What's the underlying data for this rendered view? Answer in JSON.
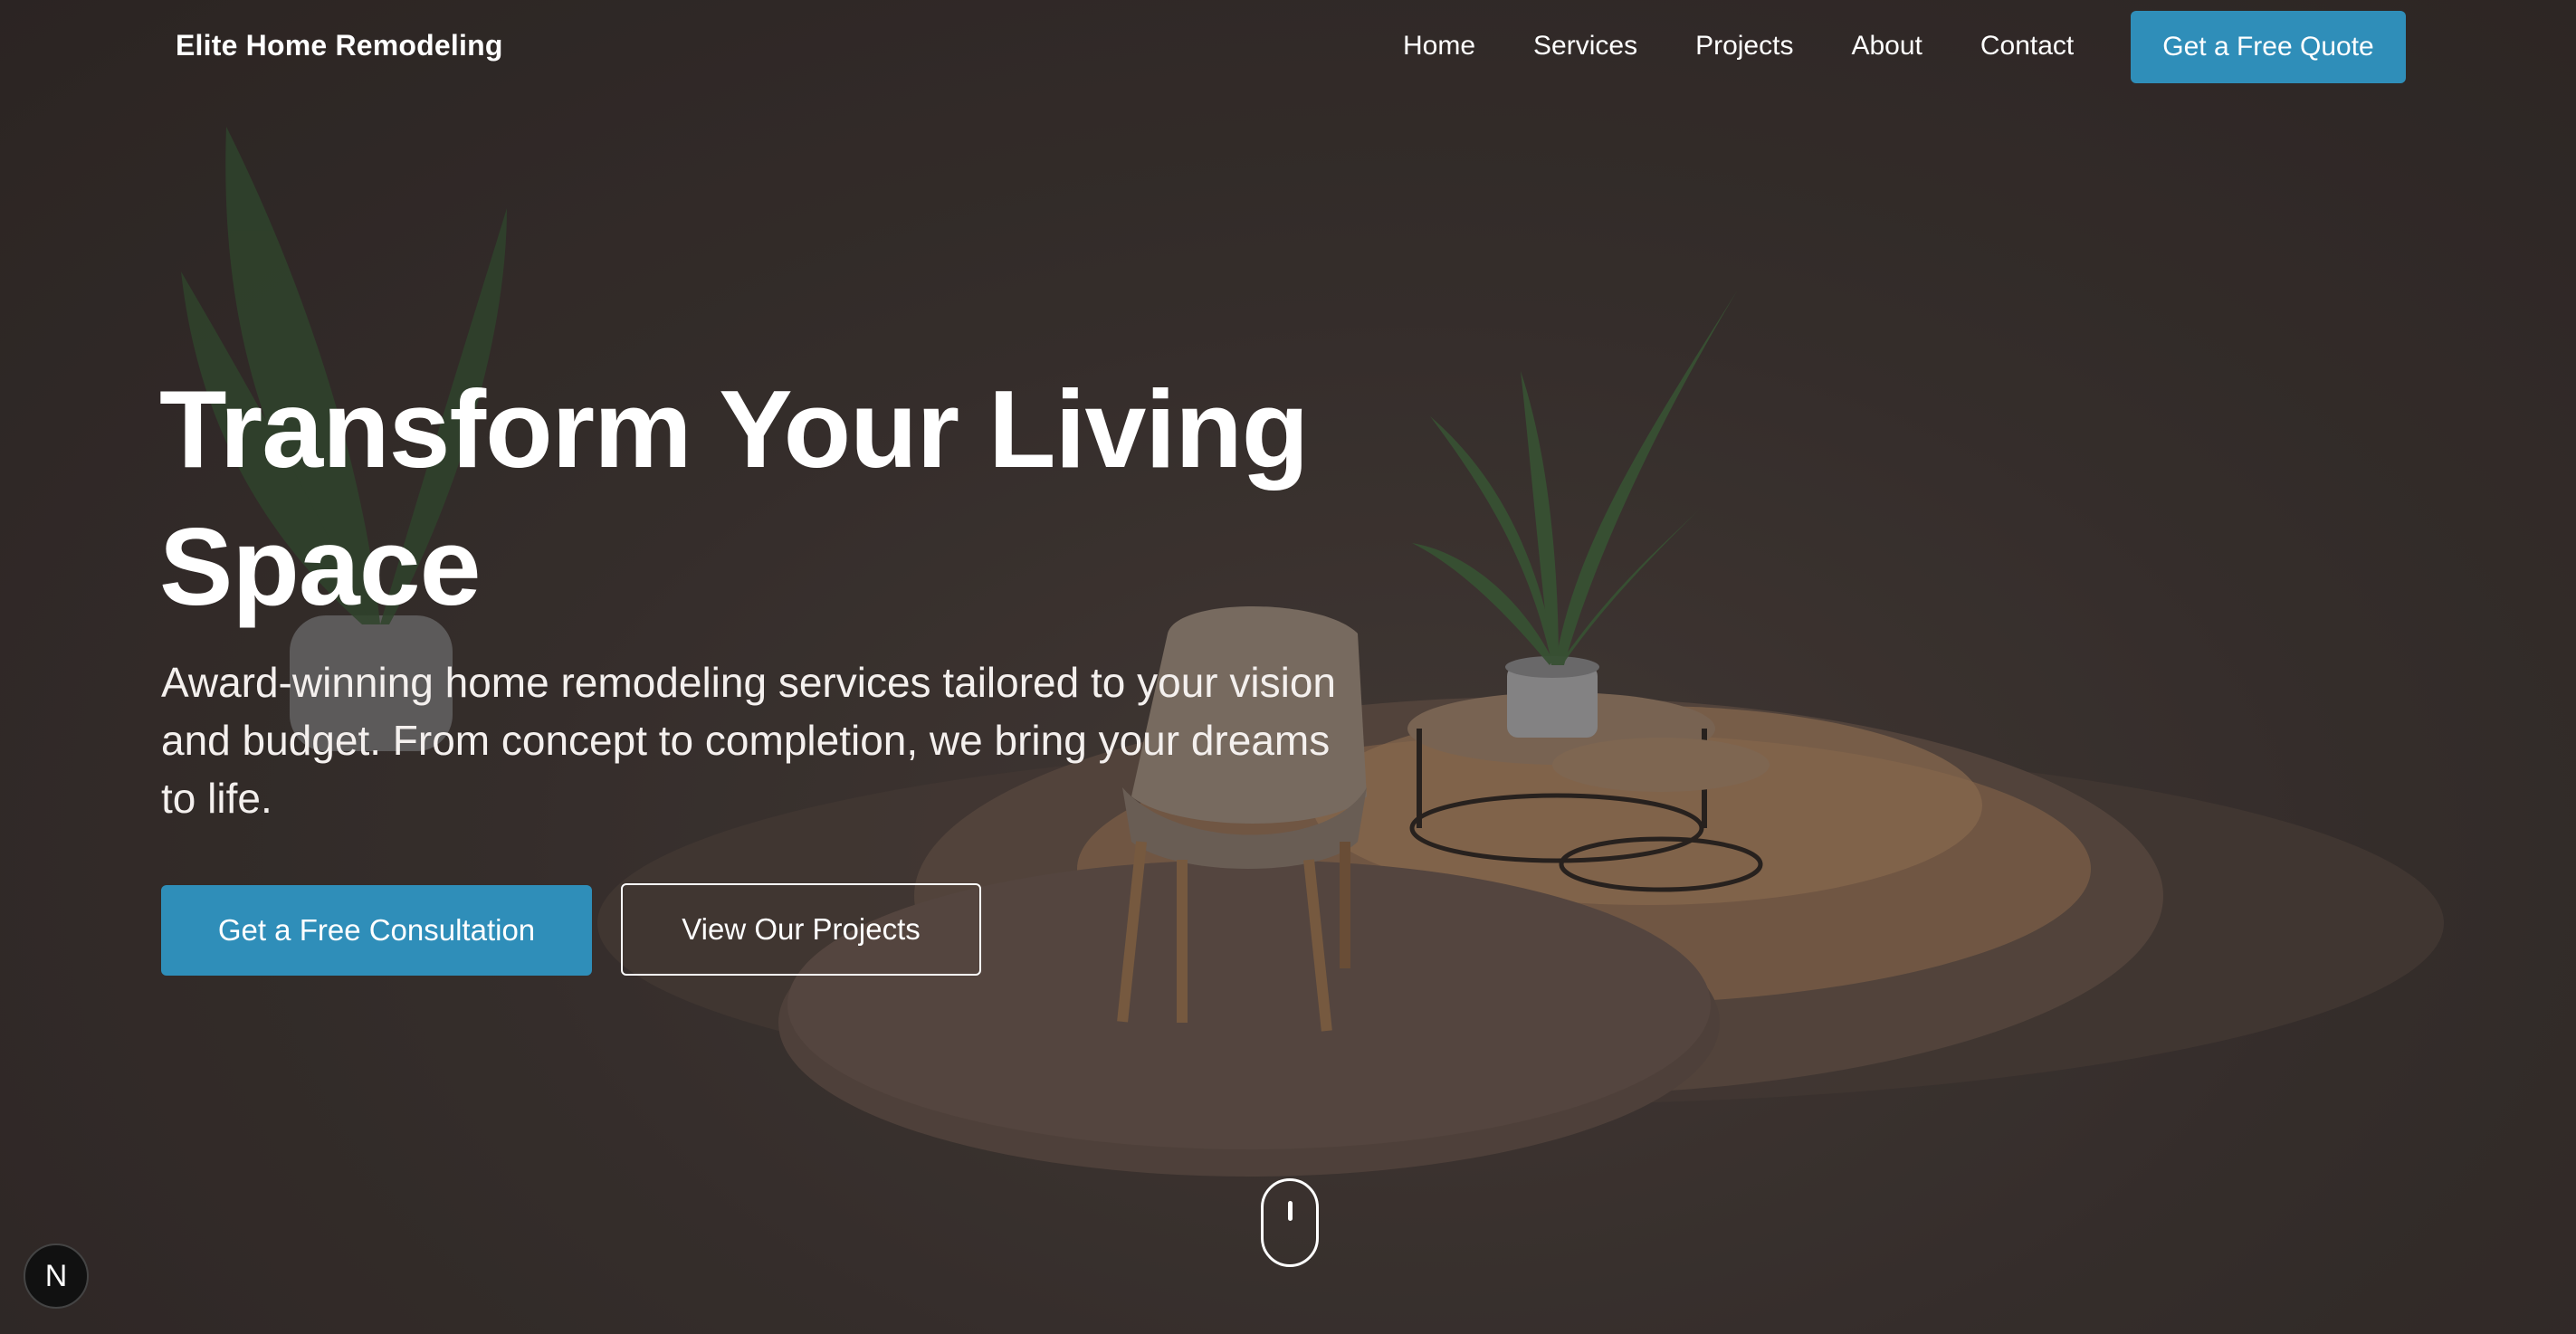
{
  "nav": {
    "brand": "Elite Home Remodeling",
    "links": [
      "Home",
      "Services",
      "Projects",
      "About",
      "Contact"
    ],
    "cta_label": "Get a Free Quote"
  },
  "hero": {
    "headline": "Transform Your Living Space",
    "subtext": "Award-winning home remodeling services tailored to your vision and budget. From concept to completion, we bring your dreams to life.",
    "primary_cta": "Get a Free Consultation",
    "secondary_cta": "View Our Projects"
  },
  "badge": {
    "letter": "N"
  },
  "colors": {
    "accent": "#2f8eb9",
    "background": "#3a3230",
    "text": "#ffffff"
  },
  "icons": {
    "scroll": "mouse-scroll-icon",
    "badge": "next-logo-icon"
  }
}
